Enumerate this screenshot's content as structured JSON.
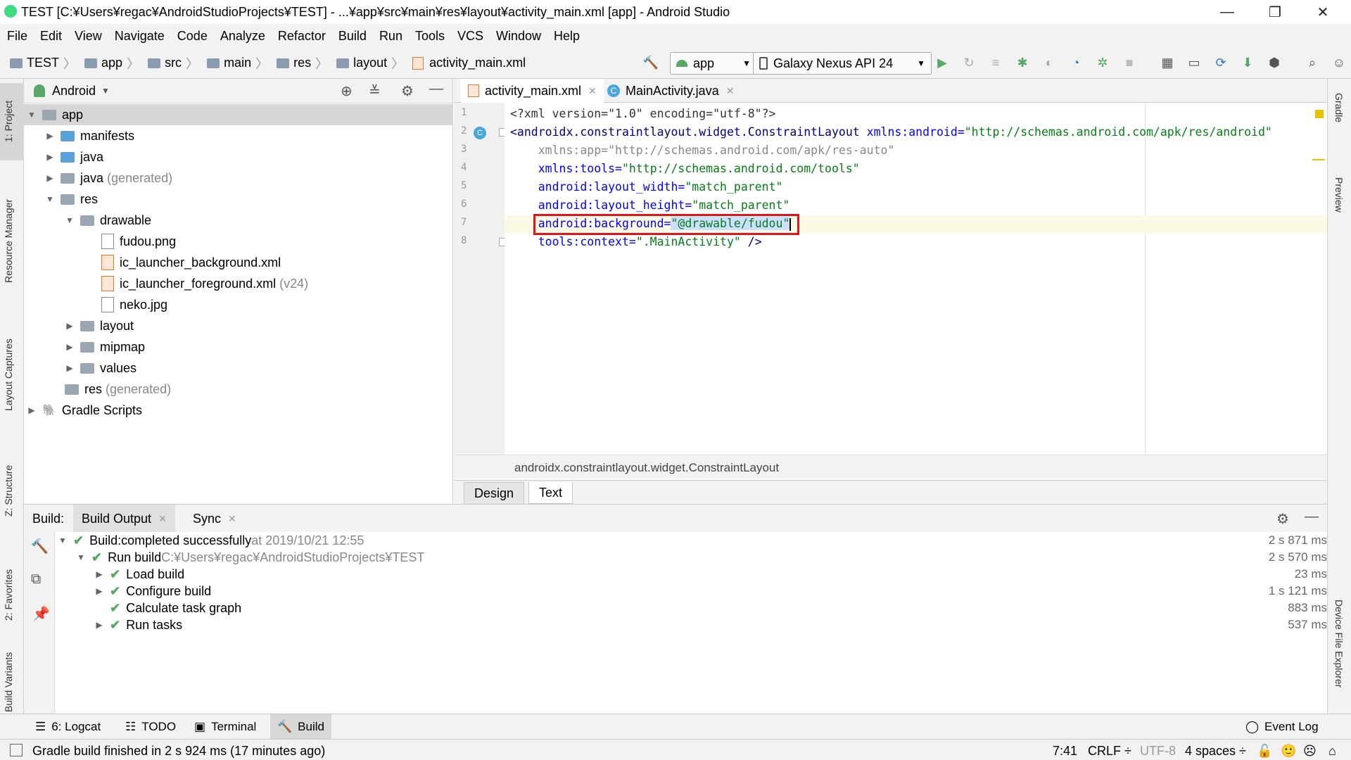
{
  "window": {
    "title": "TEST [C:¥Users¥regac¥AndroidStudioProjects¥TEST] - ...¥app¥src¥main¥res¥layout¥activity_main.xml [app] - Android Studio",
    "minimize": "—",
    "maximize": "❐",
    "close": "✕"
  },
  "menu": [
    "File",
    "Edit",
    "View",
    "Navigate",
    "Code",
    "Analyze",
    "Refactor",
    "Build",
    "Run",
    "Tools",
    "VCS",
    "Window",
    "Help"
  ],
  "breadcrumbs": [
    "TEST",
    "app",
    "src",
    "main",
    "res",
    "layout",
    "activity_main.xml"
  ],
  "toolbar": {
    "run_config": "app",
    "device": "Galaxy Nexus API 24"
  },
  "left_stripe": [
    "1: Project",
    "Resource Manager",
    "Layout Captures",
    "Z: Structure",
    "2: Favorites",
    "Build Variants"
  ],
  "right_stripe": [
    "Gradle",
    "Preview",
    "Device File Explorer"
  ],
  "project": {
    "view_mode": "Android",
    "tree": [
      {
        "label": "app",
        "extra": ""
      },
      {
        "label": "manifests",
        "extra": ""
      },
      {
        "label": "java",
        "extra": ""
      },
      {
        "label": "java",
        "extra": "(generated)"
      },
      {
        "label": "res",
        "extra": ""
      },
      {
        "label": "drawable",
        "extra": ""
      },
      {
        "label": "fudou.png",
        "extra": ""
      },
      {
        "label": "ic_launcher_background.xml",
        "extra": ""
      },
      {
        "label": "ic_launcher_foreground.xml",
        "extra": "(v24)"
      },
      {
        "label": "neko.jpg",
        "extra": ""
      },
      {
        "label": "layout",
        "extra": ""
      },
      {
        "label": "mipmap",
        "extra": ""
      },
      {
        "label": "values",
        "extra": ""
      },
      {
        "label": "res",
        "extra": "(generated)"
      },
      {
        "label": "Gradle Scripts",
        "extra": ""
      }
    ]
  },
  "editor": {
    "tabs": [
      "activity_main.xml",
      "MainActivity.java"
    ],
    "line_numbers": [
      "1",
      "2",
      "3",
      "4",
      "5",
      "6",
      "7",
      "8"
    ],
    "code": {
      "l1": "<?xml version=\"1.0\" encoding=\"utf-8\"?>",
      "l2_tag": "<androidx.constraintlayout.widget.ConstraintLayout ",
      "l2_attr": "xmlns:android=",
      "l2_val": "\"http://schemas.android.com/apk/res/android\"",
      "l3": "    xmlns:app=\"http://schemas.android.com/apk/res-auto\"",
      "l4_attr": "    xmlns:tools=",
      "l4_val": "\"http://schemas.android.com/tools\"",
      "l5_attr": "    android:layout_width=",
      "l5_val": "\"match_parent\"",
      "l6_attr": "    android:layout_height=",
      "l6_val": "\"match_parent\"",
      "l7_attr": "    android:background=",
      "l7_val": "\"@drawable/fudou\"",
      "l8_attr": "    tools:context=",
      "l8_val": "\".MainActivity\"",
      "l8_end": " />"
    },
    "breadcrumb": "androidx.constraintlayout.widget.ConstraintLayout",
    "bottom_tabs": [
      "Design",
      "Text"
    ]
  },
  "build": {
    "label": "Build:",
    "tabs": [
      "Build Output",
      "Sync"
    ],
    "lines": [
      {
        "text": "Build:",
        "rest": " completed successfully",
        "extra": " at 2019/10/21 12:55",
        "time": "2 s 871 ms"
      },
      {
        "text": "Run build",
        "rest": "",
        "extra": " C:¥Users¥regac¥AndroidStudioProjects¥TEST",
        "time": "2 s 570 ms"
      },
      {
        "text": "Load build",
        "rest": "",
        "extra": "",
        "time": "23 ms"
      },
      {
        "text": "Configure build",
        "rest": "",
        "extra": "",
        "time": "1 s 121 ms"
      },
      {
        "text": "Calculate task graph",
        "rest": "",
        "extra": "",
        "time": "883 ms"
      },
      {
        "text": "Run tasks",
        "rest": "",
        "extra": "",
        "time": "537 ms"
      }
    ]
  },
  "bottom_tools": [
    "6: Logcat",
    "TODO",
    "Terminal",
    "Build"
  ],
  "event_log": "Event Log",
  "status": {
    "message": "Gradle build finished in 2 s 924 ms (17 minutes ago)",
    "position": "7:41",
    "line_sep": "CRLF ÷",
    "encoding": "UTF-8",
    "indent": "4 spaces ÷"
  }
}
